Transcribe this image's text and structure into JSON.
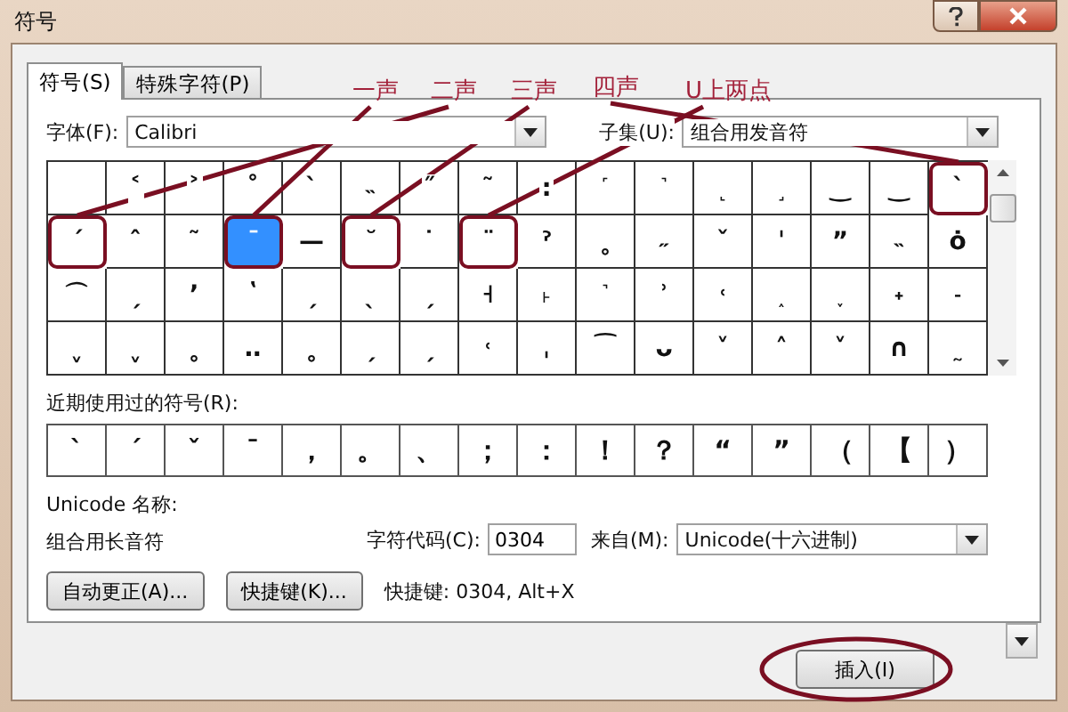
{
  "window": {
    "title": "符号"
  },
  "tabs": [
    {
      "label": "符号(S)",
      "selected": true
    },
    {
      "label": "特殊字符(P)",
      "selected": false
    }
  ],
  "font": {
    "label": "字体(F):",
    "value": "Calibri"
  },
  "subset": {
    "label": "子集(U):",
    "value": "组合用发音符"
  },
  "callouts": [
    {
      "label": "一声"
    },
    {
      "label": "二声"
    },
    {
      "label": "三声"
    },
    {
      "label": "四声"
    },
    {
      "label": "U上两点"
    }
  ],
  "grid": [
    [
      {
        "selected": false
      },
      {
        "symbol": "˂",
        "selected": false
      },
      {
        "symbol": "˃",
        "selected": false
      },
      {
        "symbol": "˚",
        "selected": false
      },
      {
        "symbol": "ˋ",
        "selected": false
      },
      {
        "symbol": "˵",
        "selected": false
      },
      {
        "symbol": "˝",
        "selected": false
      },
      {
        "symbol": "˜",
        "selected": false
      },
      {
        "symbol": ":",
        "selected": false
      },
      {
        "symbol": "˹",
        "selected": false
      },
      {
        "symbol": "˺",
        "selected": false
      },
      {
        "symbol": "˻",
        "selected": false
      },
      {
        "symbol": "˼",
        "selected": false
      },
      {
        "symbol": "‿",
        "selected": false
      },
      {
        "symbol": "‿",
        "selected": false
      },
      {
        "symbol": "ˋ",
        "selected": false,
        "circled": true
      }
    ],
    [
      {
        "symbol": "ˊ",
        "selected": false,
        "circled": true
      },
      {
        "symbol": "ˆ",
        "selected": false
      },
      {
        "symbol": "˜",
        "selected": false
      },
      {
        "symbol": "ˉ",
        "selected": true,
        "circled": true
      },
      {
        "symbol": "—",
        "selected": false
      },
      {
        "symbol": "˘",
        "selected": false,
        "circled": true
      },
      {
        "symbol": "˙",
        "selected": false
      },
      {
        "symbol": "¨",
        "selected": false,
        "circled": true
      },
      {
        "symbol": "ˀ",
        "selected": false
      },
      {
        "symbol": "˳",
        "selected": false
      },
      {
        "symbol": "˶",
        "selected": false
      },
      {
        "symbol": "ˇ",
        "selected": false
      },
      {
        "symbol": "ˈ",
        "selected": false
      },
      {
        "symbol": "ˮ",
        "selected": false
      },
      {
        "symbol": "˵",
        "selected": false
      },
      {
        "symbol": "ȯ",
        "selected": false
      }
    ],
    [
      {
        "symbol": "⌒",
        "selected": false
      },
      {
        "symbol": "ˏ",
        "selected": false
      },
      {
        "symbol": "ʼ",
        "selected": false
      },
      {
        "symbol": "ʽ",
        "selected": false
      },
      {
        "symbol": "ˏ",
        "selected": false
      },
      {
        "symbol": "ˎ",
        "selected": false
      },
      {
        "symbol": "ˏ",
        "selected": false
      },
      {
        "symbol": "˧",
        "selected": false
      },
      {
        "symbol": "˫",
        "selected": false
      },
      {
        "symbol": "˺",
        "selected": false
      },
      {
        "symbol": "ʾ",
        "selected": false
      },
      {
        "symbol": "˓",
        "selected": false
      },
      {
        "symbol": "˰",
        "selected": false
      },
      {
        "symbol": "˯",
        "selected": false
      },
      {
        "symbol": "˖",
        "selected": false
      },
      {
        "symbol": "˗",
        "selected": false
      }
    ],
    [
      {
        "symbol": "ˬ",
        "selected": false
      },
      {
        "symbol": "ˬ",
        "selected": false
      },
      {
        "symbol": "˳",
        "selected": false
      },
      {
        "symbol": "‥",
        "selected": false
      },
      {
        "symbol": "˳",
        "selected": false
      },
      {
        "symbol": "ˏ",
        "selected": false
      },
      {
        "symbol": "ˏ",
        "selected": false
      },
      {
        "symbol": "˓",
        "selected": false
      },
      {
        "symbol": "ˌ",
        "selected": false
      },
      {
        "symbol": "⁀",
        "selected": false
      },
      {
        "symbol": "ᴗ",
        "selected": false
      },
      {
        "symbol": "˅",
        "selected": false
      },
      {
        "symbol": "˄",
        "selected": false
      },
      {
        "symbol": "˅",
        "selected": false
      },
      {
        "symbol": "∩",
        "selected": false
      },
      {
        "symbol": "˷",
        "selected": false
      }
    ]
  ],
  "recent": {
    "label": "近期使用过的符号(R):",
    "symbols": [
      "ˋ",
      "ˊ",
      "ˇ",
      "ˉ",
      "，",
      "。",
      "、",
      "；",
      "：",
      "！",
      "？",
      "“",
      "”",
      "（",
      "【",
      "）"
    ]
  },
  "unicode_name": {
    "label": "Unicode 名称:",
    "value": "组合用长音符"
  },
  "char_code": {
    "label": "字符代码(C):",
    "value": "0304"
  },
  "from": {
    "label": "来自(M):",
    "value": "Unicode(十六进制)"
  },
  "buttons": [
    {
      "label": "自动更正(A)..."
    },
    {
      "label": "快捷键(K)..."
    }
  ],
  "shortcut": "快捷键: 0304, Alt+X",
  "insert_button": {
    "label": "插入(I)",
    "circled": true
  }
}
